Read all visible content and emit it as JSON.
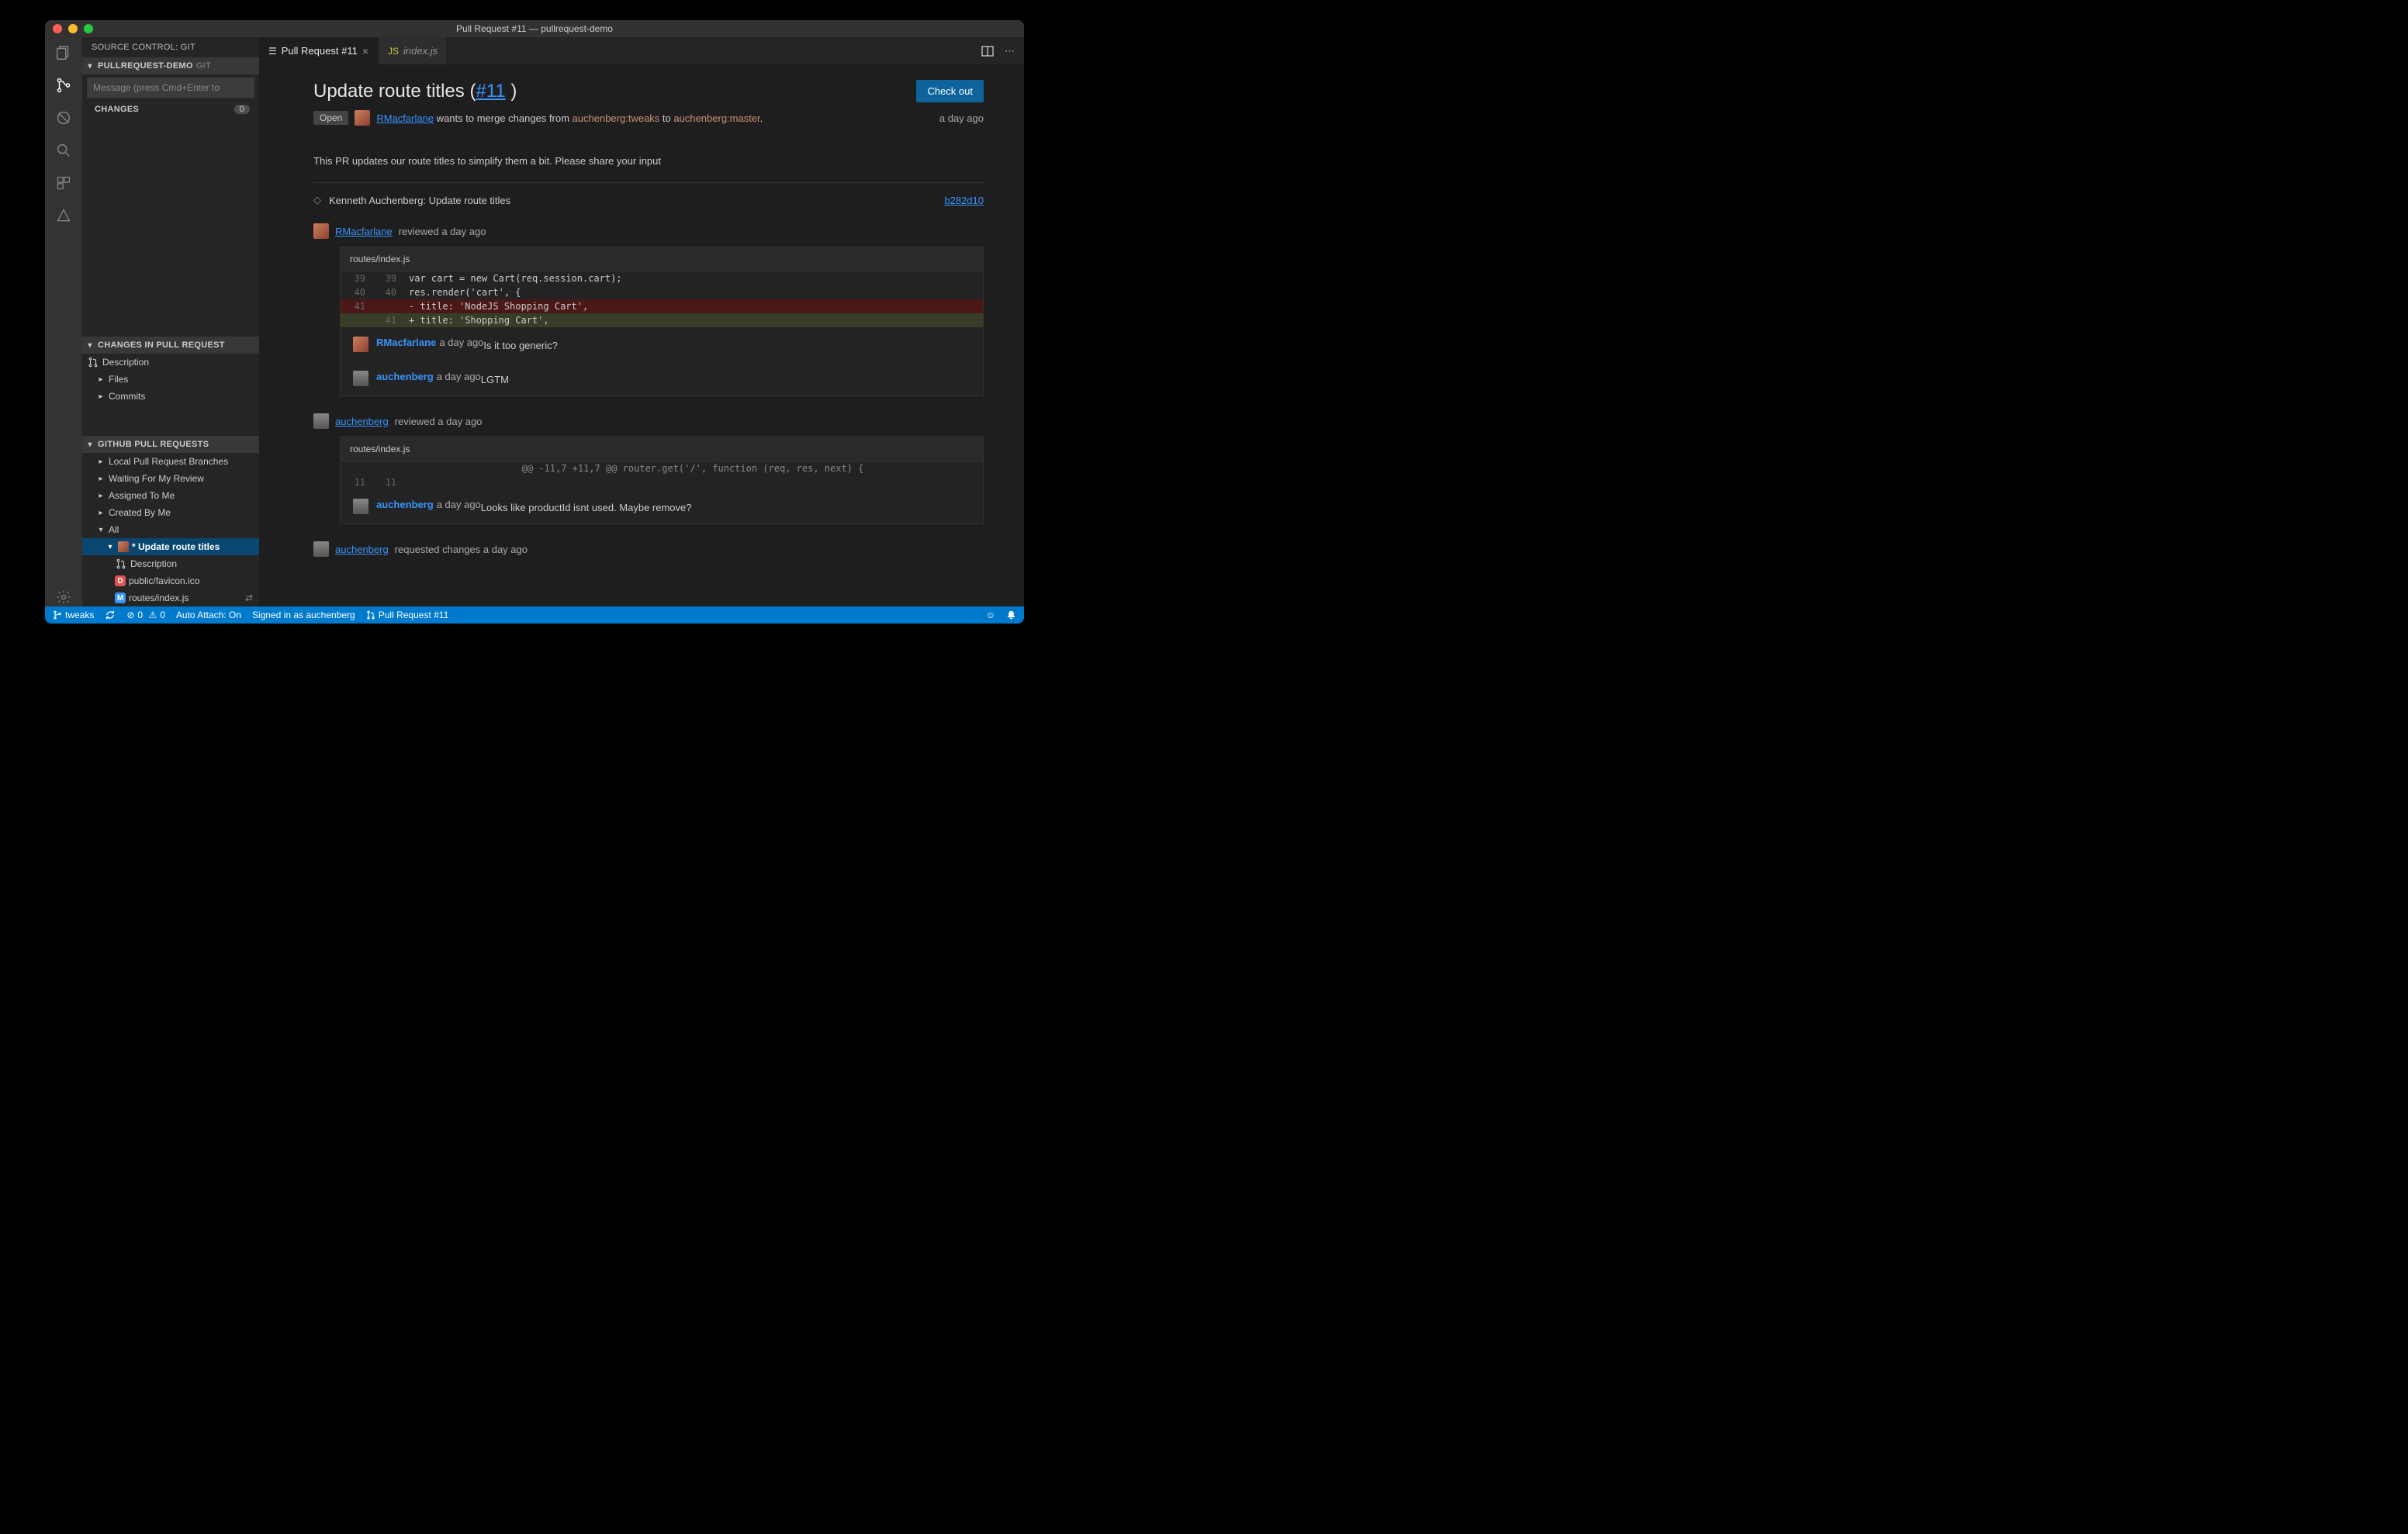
{
  "titlebar": {
    "title": "Pull Request #11 — pullrequest-demo"
  },
  "sidebar": {
    "panel_title": "SOURCE CONTROL: GIT",
    "repo_header": {
      "name": "PULLREQUEST-DEMO",
      "kind": "GIT"
    },
    "msg_placeholder": "Message (press Cmd+Enter to",
    "changes_label": "CHANGES",
    "changes_count": "0",
    "sect_changes_pr": "CHANGES IN PULL REQUEST",
    "pr_changes": {
      "description": "Description",
      "files": "Files",
      "commits": "Commits"
    },
    "sect_github_pr": "GITHUB PULL REQUESTS",
    "ghpr": {
      "local": "Local Pull Request Branches",
      "waiting": "Waiting For My Review",
      "assigned": "Assigned To Me",
      "created": "Created By Me",
      "all": "All",
      "selected": "* Update route titles",
      "sel_desc": "Description",
      "sel_file1": "public/favicon.ico",
      "sel_file2": "routes/index.js"
    }
  },
  "tabs": {
    "t0": "Pull Request #11",
    "t1": "index.js"
  },
  "pr": {
    "title_text": "Update route titles (",
    "title_num": "#11",
    "title_close": " )",
    "checkout": "Check out",
    "state": "Open",
    "author": "RMacfarlane",
    "merge_pre": " wants to merge changes from ",
    "branch_src": "auchenberg:tweaks",
    "merge_mid": " to ",
    "branch_dst": "auchenberg:master",
    "period": ".",
    "age": "a day ago",
    "body": "This PR updates our route titles to simplify them a bit. Please share your input",
    "commit_author": "Kenneth Auchenberg: Update route titles",
    "commit_sha": "b282d10"
  },
  "review1": {
    "who": "RMacfarlane",
    "status": "reviewed a day ago",
    "path": "routes/index.js",
    "l1o": "39",
    "l1n": "39",
    "l1": "var cart = new Cart(req.session.cart);",
    "l2o": "40",
    "l2n": "40",
    "l2": "res.render('cart', {",
    "l3o": "41",
    "l3": "- title: 'NodeJS Shopping Cart',",
    "l4n": "41",
    "l4": "+ title: 'Shopping Cart',",
    "c1_who": "RMacfarlane",
    "c1_when": "a day ago",
    "c1_text": "Is it too generic?",
    "c2_who": "auchenberg",
    "c2_when": "a day ago",
    "c2_text": "LGTM"
  },
  "review2": {
    "who": "auchenberg",
    "status": "reviewed a day ago",
    "path": "routes/index.js",
    "hunk": "@@ -11,7 +11,7 @@ router.get('/', function (req, res, next) {",
    "l1o": "11",
    "l1n": "11",
    "c1_who": "auchenberg",
    "c1_when": "a day ago",
    "c1_text": "Looks like productId isnt used. Maybe remove?"
  },
  "review3": {
    "who": "auchenberg",
    "status": "requested changes a day ago"
  },
  "status": {
    "branch": "tweaks",
    "err": "0",
    "warn": "0",
    "autoattach": "Auto Attach: On",
    "signed": "Signed in as auchenberg",
    "pr": "Pull Request #11"
  }
}
